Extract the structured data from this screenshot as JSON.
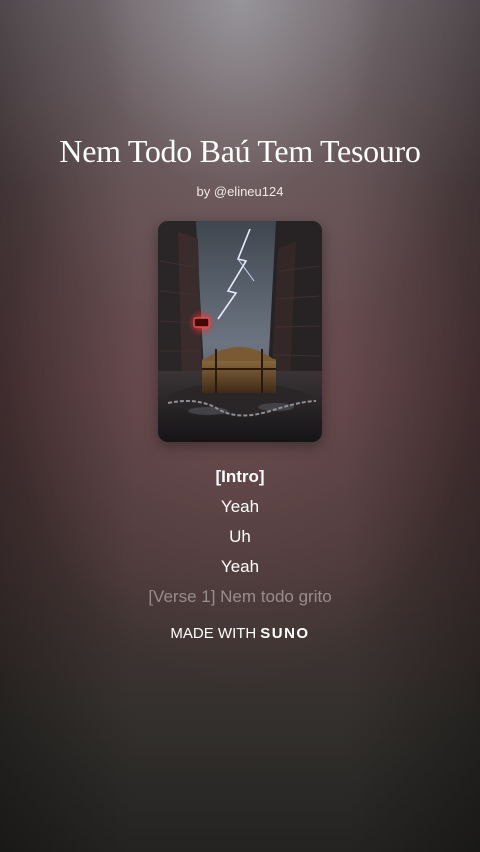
{
  "song": {
    "title": "Nem Todo Baú Tem Tesouro",
    "byline": "by @elineu124"
  },
  "cover_art": {
    "icon": "album-cover-image",
    "description_colors": {
      "sky": "#5a6470",
      "walls": "#2b2728",
      "neon": "#ff3b3b",
      "chest": "#6a4a2a"
    }
  },
  "lyrics": {
    "lines": [
      "[Intro]",
      "Yeah",
      "Uh",
      "Yeah",
      "[Verse 1] Nem todo grito"
    ]
  },
  "footer": {
    "made_with": "MADE WITH",
    "brand": "SUNO"
  }
}
